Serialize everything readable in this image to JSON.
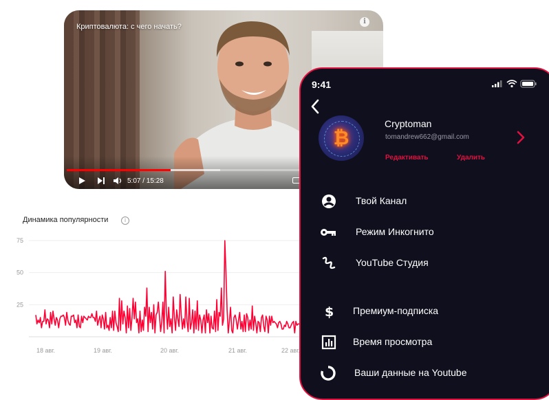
{
  "video": {
    "title": "Криптовалюта: с чего начать?",
    "info_label": "i",
    "time": "5:07 / 15:28",
    "progress": 0.331,
    "buffered": 0.49
  },
  "chart_title": "Динамика популярности",
  "chart_help": "i",
  "chart_data": {
    "type": "line",
    "title": "Динамика популярности",
    "xlabel": "",
    "ylabel": "",
    "ylim": [
      0,
      75
    ],
    "yticks": [
      25,
      50,
      75
    ],
    "x_tick_labels": [
      "18 авг.",
      "19 авг.",
      "20 авг.",
      "21 авг.",
      "22 авг."
    ],
    "grid": true,
    "color": "#ff0033",
    "series": [
      {
        "values": [
          17,
          10,
          13,
          11,
          15,
          7,
          12,
          12,
          21,
          10,
          14,
          13,
          7,
          19,
          10,
          20,
          14,
          9,
          15,
          13,
          7,
          14,
          16,
          16,
          17,
          15,
          9,
          19,
          13,
          10,
          9,
          16,
          16,
          17,
          11,
          13,
          7,
          17,
          8,
          7,
          16,
          11,
          16,
          15,
          14,
          13,
          16,
          15,
          15,
          18,
          15,
          15,
          12,
          20,
          9,
          13,
          16,
          7,
          17,
          14,
          6,
          19,
          7,
          9,
          5,
          15,
          7,
          20,
          5,
          20,
          11,
          8,
          4,
          30,
          5,
          28,
          10,
          20,
          15,
          3,
          24,
          7,
          22,
          5,
          15,
          30,
          14,
          27,
          11,
          14,
          3,
          20,
          4,
          13,
          5,
          23,
          16,
          38,
          4,
          23,
          11,
          19,
          6,
          25,
          3,
          17,
          19,
          27,
          16,
          4,
          12,
          27,
          3,
          51,
          20,
          6,
          23,
          8,
          14,
          3,
          31,
          15,
          5,
          21,
          14,
          8,
          33,
          17,
          6,
          14,
          7,
          31,
          12,
          4,
          30,
          6,
          11,
          21,
          3,
          20,
          6,
          28,
          5,
          17,
          13,
          3,
          13,
          17,
          3,
          21,
          11,
          18,
          3,
          16,
          7,
          6,
          20,
          4,
          29,
          5,
          19,
          16,
          38,
          9,
          14,
          75,
          51,
          21,
          3,
          12,
          23,
          5,
          3,
          15,
          17,
          13,
          6,
          13,
          19,
          6,
          12,
          4,
          17,
          4,
          18,
          15,
          5,
          13,
          6,
          24,
          5,
          16,
          11,
          3,
          12,
          11,
          4,
          15,
          17,
          8,
          4,
          16,
          13,
          3,
          16,
          9,
          16,
          11,
          12,
          11,
          10,
          7,
          11,
          12,
          10,
          6,
          6,
          9,
          8,
          12,
          10,
          7,
          7,
          9,
          11,
          12,
          3,
          12,
          9,
          10,
          10,
          10,
          8,
          10
        ]
      }
    ]
  },
  "phone": {
    "status_time": "9:41",
    "user_name": "Cryptoman",
    "user_email": "tomandrew662@gmail.com",
    "edit_label": "Редактивать",
    "delete_label": "Удалить",
    "menu": [
      {
        "label": "Твой Канал",
        "icon": "account-circle-icon"
      },
      {
        "label": "Режим Инкогнито",
        "icon": "key-icon"
      },
      {
        "label": "YouTube Студия",
        "icon": "studio-icon"
      },
      {
        "label": "Премиум-подписка",
        "icon": "dollar-icon"
      },
      {
        "label": "Время просмотра",
        "icon": "bar-chart-icon"
      },
      {
        "label": "Ваши данные на Youtube",
        "icon": "donut-icon"
      }
    ]
  },
  "colors": {
    "accent": "#e0123f",
    "phone_bg": "#0f0f1e",
    "chart_line": "#ff0033"
  }
}
